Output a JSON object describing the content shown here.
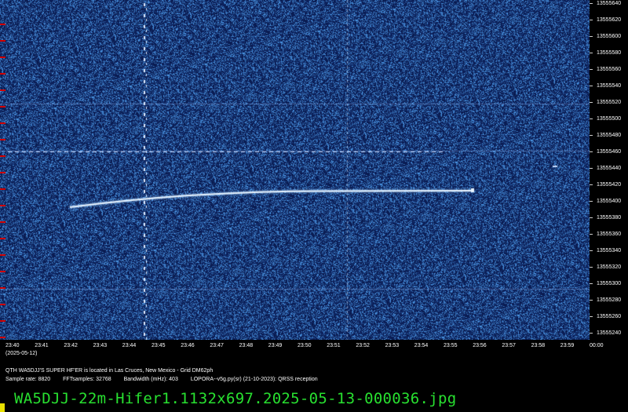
{
  "waterfall": {
    "background_color": "#0b1f5c",
    "noise_color": "#3f6fc0",
    "trace_color": "#e8f4ff",
    "tick_color": "#d00000"
  },
  "frequency_axis": {
    "min": 13555230,
    "max": 13555640,
    "labels": [
      "13555640",
      "13555620",
      "13555600",
      "13555580",
      "13555560",
      "13555540",
      "13555520",
      "13555500",
      "13555480",
      "13555460",
      "13555440",
      "13555420",
      "13555400",
      "13555380",
      "13555360",
      "13555340",
      "13555320",
      "13555300",
      "13555280",
      "13555260",
      "13555240"
    ]
  },
  "time_axis": {
    "labels": [
      "23:40",
      "23:41",
      "23:42",
      "23:43",
      "23:44",
      "23:45",
      "23:46",
      "23:47",
      "23:48",
      "23:49",
      "23:50",
      "23:51",
      "23:52",
      "23:53",
      "23:54",
      "23:55",
      "23:56",
      "23:57",
      "23:58",
      "23:59",
      "00:00"
    ]
  },
  "date_label": "(2025-05-12)",
  "footer": {
    "qth_line": "QTH WA5DJJ'S SUPER HF'ER is located in Las Cruces, New Mexico - Grid DM62ph",
    "sample_rate": "Sample rate: 8820",
    "fft_samples": "FFTsamples: 32768",
    "bandwidth": "Bandwidth (mHz): 403",
    "software": "LOPORA--v5g.py(sr) (21-10-2023): QRSS reception"
  },
  "filename": "WA5DJJ-22m-Hifer1.1132x697.2025-05-13-000036.jpg"
}
